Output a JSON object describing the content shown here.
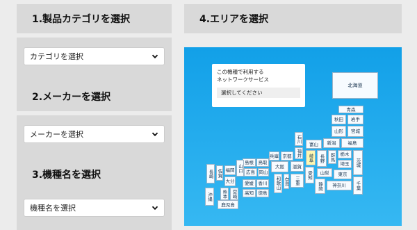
{
  "step1": {
    "title": "1.製品カテゴリを選択",
    "select_value": "カテゴリを選択"
  },
  "step2": {
    "title": "2.メーカーを選択",
    "select_value": "メーカーを選択"
  },
  "step3": {
    "title": "3.機種名を選択",
    "select_value": "機種名を選択"
  },
  "step4": {
    "title": "4.エリアを選択"
  },
  "map": {
    "popup_line1": "この機種で利用する",
    "popup_line2": "ネットワークサービス",
    "popup_select": "選択してください",
    "prefectures": {
      "hokkaido": "北海道",
      "aomori": "青森",
      "akita": "秋田",
      "iwate": "岩手",
      "yamagata": "山形",
      "miyagi": "宮城",
      "niigata": "新潟",
      "fukushima": "福島",
      "ishikawa": "石川",
      "toyama": "富山",
      "fukui": "福井",
      "gifu": "岐阜",
      "nagano": "長野",
      "gunma": "群馬",
      "tochigi": "栃木",
      "ibaraki": "茨城",
      "saitama": "埼玉",
      "yamanashi": "山梨",
      "tokyo": "東京",
      "chiba": "千葉",
      "kanagawa": "神奈川",
      "shizuoka": "静岡",
      "aichi": "愛知",
      "mie": "三重",
      "shiga": "滋賀",
      "kyoto": "京都",
      "hyogo": "兵庫",
      "osaka": "大阪",
      "nara": "奈良",
      "wakayama": "和歌山",
      "shimane": "島根",
      "tottori": "鳥取",
      "yamaguchi": "山口",
      "hiroshima": "広島",
      "okayama": "岡山",
      "ehime": "愛媛",
      "kagawa": "香川",
      "kochi": "高知",
      "tokushima": "徳島",
      "fukuoka": "福岡",
      "saga": "佐賀",
      "nagasaki": "長崎",
      "oita": "大分",
      "kumamoto": "熊本",
      "miyazaki": "宮崎",
      "kagoshima": "鹿児島",
      "okinawa": "沖縄"
    }
  }
}
